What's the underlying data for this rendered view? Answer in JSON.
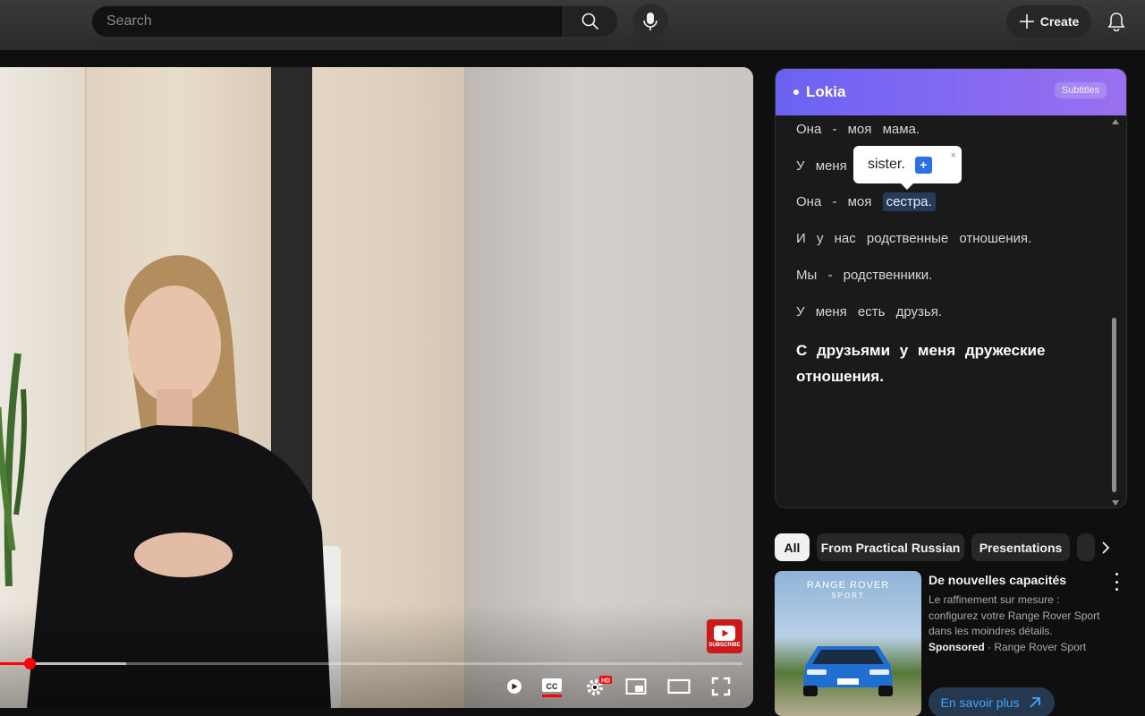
{
  "search": {
    "placeholder": "Search"
  },
  "header": {
    "create_label": "Create"
  },
  "player": {
    "progress_fraction": 0.04,
    "buffered_fraction": 0.17,
    "subscribe_label": "SUBSCRIBE",
    "settings_badge": "HD",
    "cc_label": "CC"
  },
  "lokia": {
    "title": "Lokia",
    "badge": "Subtitles",
    "lines": [
      "Она - моя мама.",
      "У меня",
      "Она - моя",
      "сестра.",
      "И у нас родственные отношения.",
      "Мы - родственники.",
      "У меня есть друзья.",
      "С друзьями у меня дружеские отношения."
    ],
    "popup": {
      "translation": "sister.",
      "add": "+",
      "close": "×"
    }
  },
  "chips": [
    "All",
    "From Practical Russian",
    "Presentations"
  ],
  "ad": {
    "brand_line1": "RANGE ROVER",
    "brand_line2": "SPORT",
    "title": "De nouvelles capacités",
    "description": "Le raffinement sur mesure : configurez votre Range Rover Sport dans les moindres détails.",
    "sponsored": "Sponsored",
    "advertiser": "· Range Rover Sport",
    "cta": "En savoir plus"
  },
  "colors": {
    "accent_red": "#ff0000",
    "lokia_gradient_start": "#6b62f2",
    "lokia_gradient_end": "#9a70f0",
    "link_blue": "#3ea6ff"
  }
}
